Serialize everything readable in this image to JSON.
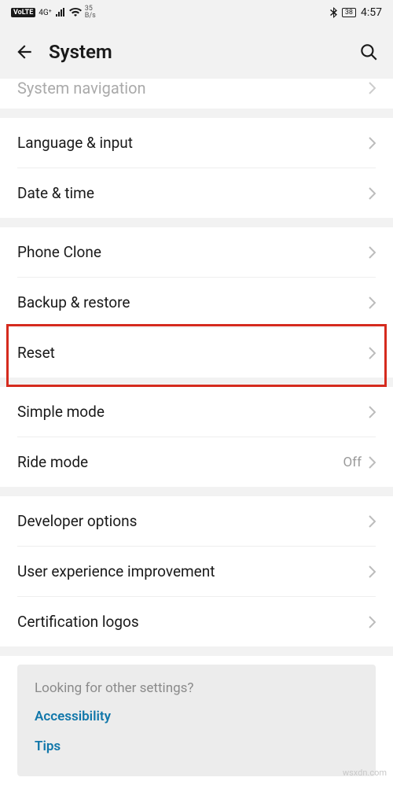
{
  "status": {
    "volte": "VoLTE",
    "net_indicator": "4G⁺",
    "speed_top": "35",
    "speed_bottom": "B/s",
    "battery": "38",
    "time": "4:57"
  },
  "header": {
    "title": "System"
  },
  "groups": [
    {
      "items": [
        {
          "label": "System navigation",
          "cut": true
        }
      ]
    },
    {
      "items": [
        {
          "label": "Language & input"
        },
        {
          "label": "Date & time"
        }
      ]
    },
    {
      "items": [
        {
          "label": "Phone Clone"
        },
        {
          "label": "Backup & restore"
        },
        {
          "label": "Reset",
          "highlight": true
        }
      ]
    },
    {
      "items": [
        {
          "label": "Simple mode"
        },
        {
          "label": "Ride mode",
          "value": "Off"
        }
      ]
    },
    {
      "items": [
        {
          "label": "Developer options"
        },
        {
          "label": "User experience improvement"
        },
        {
          "label": "Certification logos"
        }
      ]
    }
  ],
  "tips": {
    "title": "Looking for other settings?",
    "links": [
      "Accessibility",
      "Tips"
    ]
  },
  "highlight_color": "#d52b1e",
  "watermark": "wsxdn.com"
}
